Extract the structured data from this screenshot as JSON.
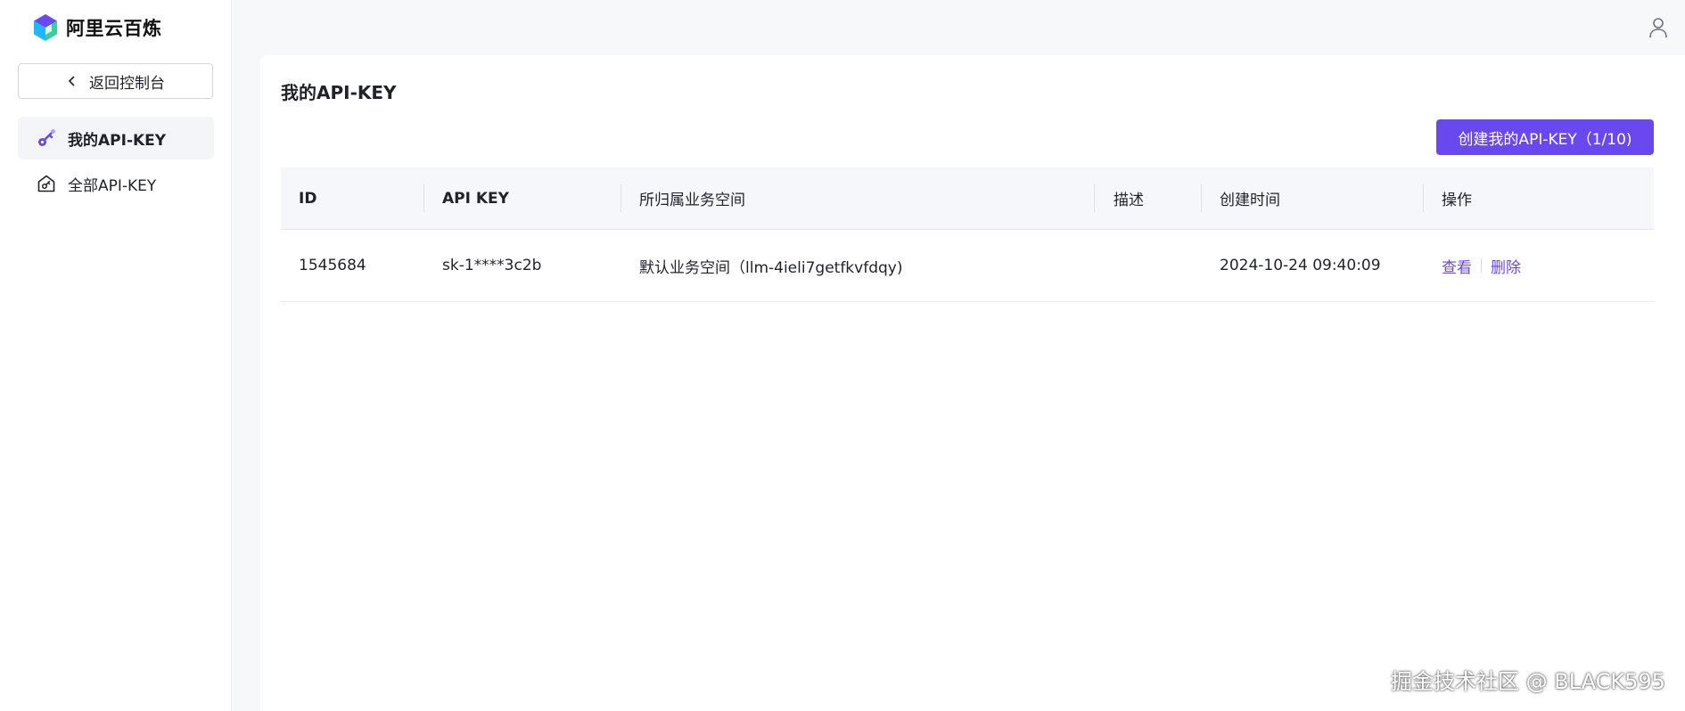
{
  "brand": {
    "name": "阿里云百炼"
  },
  "sidebar": {
    "back_label": "返回控制台",
    "items": [
      {
        "label": "我的API-KEY",
        "icon": "key-icon",
        "active": true
      },
      {
        "label": "全部API-KEY",
        "icon": "house-key-icon",
        "active": false
      }
    ]
  },
  "main": {
    "title": "我的API-KEY",
    "create_button": "创建我的API-KEY（1/10)",
    "table": {
      "columns": [
        "ID",
        "API KEY",
        "所归属业务空间",
        "描述",
        "创建时间",
        "操作"
      ],
      "rows": [
        {
          "id": "1545684",
          "api_key": "sk-1****3c2b",
          "workspace": "默认业务空间（llm-4ieli7getfkvfdqy)",
          "description": "",
          "created": "2024-10-24 09:40:09",
          "actions": [
            "查看",
            "删除"
          ]
        }
      ]
    }
  },
  "watermark": "掘金技术社区 @ BLACK595",
  "colors": {
    "accent": "#6a48f0",
    "background": "#f7f8fa"
  }
}
